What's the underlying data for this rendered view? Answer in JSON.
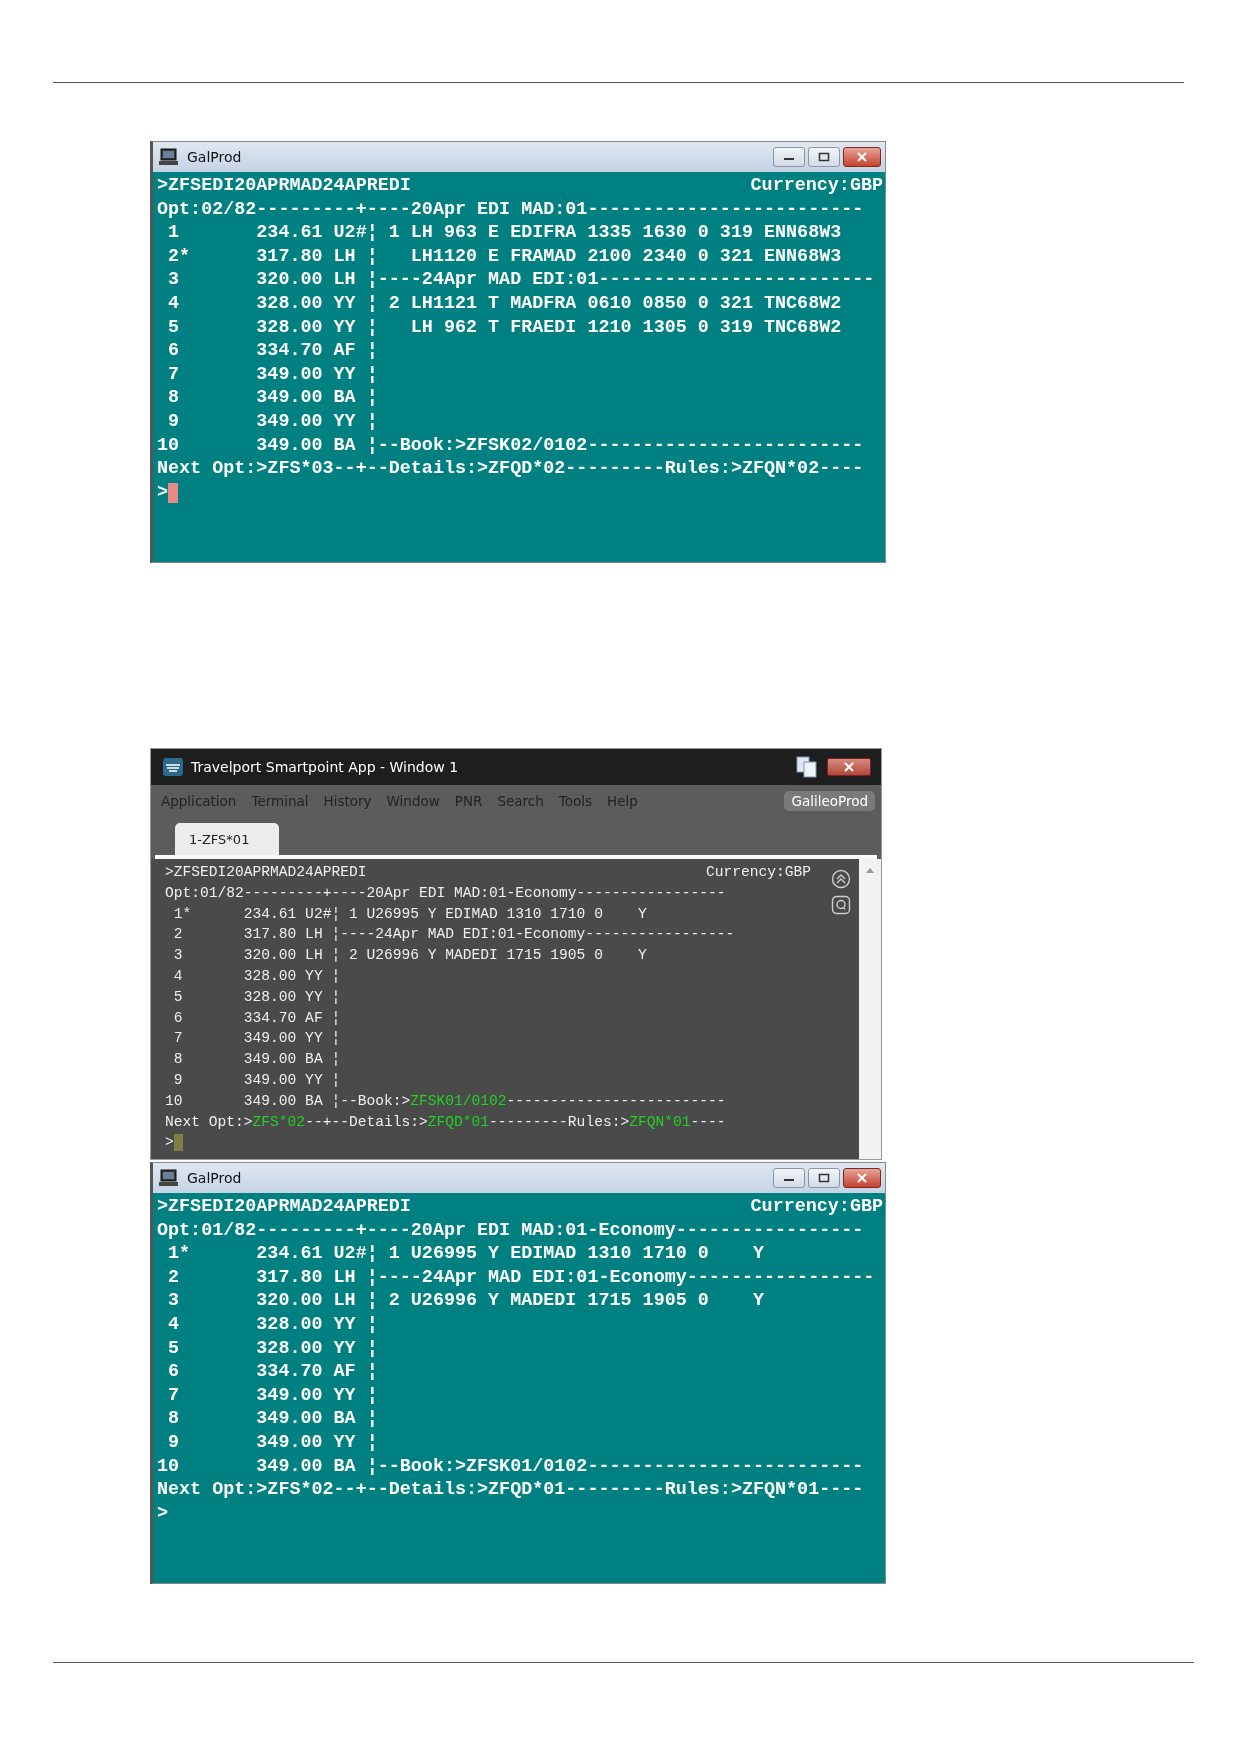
{
  "windows": [
    {
      "kind": "classic",
      "title": "GalProd",
      "terminal": {
        "command": ">ZFSEDI20APRMAD24APREDI",
        "currency": "Currency:GBP",
        "prompt": ">",
        "cursor": true,
        "lines": [
          [
            {
              "text": "Opt:02/82---------+----20Apr EDI MAD:01-------------------------",
              "kind": "plain"
            }
          ],
          [
            {
              "text": " 1       234.61 U2#¦ 1 LH 963 E EDIFRA 1335 1630 0 319 ENN68W3",
              "kind": "plain"
            }
          ],
          [
            {
              "text": " 2*      317.80 LH ¦   LH1120 E FRAMAD 2100 2340 0 321 ENN68W3",
              "kind": "plain"
            }
          ],
          [
            {
              "text": " 3       320.00 LH ¦----24Apr MAD EDI:01-------------------------",
              "kind": "plain"
            }
          ],
          [
            {
              "text": " 4       328.00 YY ¦ 2 LH1121 T MADFRA 0610 0850 0 321 TNC68W2",
              "kind": "plain"
            }
          ],
          [
            {
              "text": " 5       328.00 YY ¦   LH 962 T FRAEDI 1210 1305 0 319 TNC68W2",
              "kind": "plain"
            }
          ],
          [
            {
              "text": " 6       334.70 AF ¦",
              "kind": "plain"
            }
          ],
          [
            {
              "text": " 7       349.00 YY ¦",
              "kind": "plain"
            }
          ],
          [
            {
              "text": " 8       349.00 BA ¦",
              "kind": "plain"
            }
          ],
          [
            {
              "text": " 9       349.00 YY ¦",
              "kind": "plain"
            }
          ],
          [
            {
              "text": "10       349.00 BA ¦--Book:>ZFSK02/0102-------------------------",
              "kind": "plain"
            }
          ],
          [
            {
              "text": "Next Opt:>ZFS*03--+--Details:>ZFQD*02---------Rules:>ZFQN*02----",
              "kind": "plain"
            }
          ]
        ]
      }
    },
    {
      "kind": "smartpoint",
      "title": "Travelport Smartpoint App - Window 1",
      "menu": [
        "Application",
        "Terminal",
        "History",
        "Window",
        "PNR",
        "Search",
        "Tools",
        "Help"
      ],
      "profile": "GalileoProd",
      "tabs": [
        {
          "label": "1-ZFS*01",
          "selected": true
        }
      ],
      "terminal": {
        "command": ">ZFSEDI20APRMAD24APREDI",
        "currency": "Currency:GBP",
        "prompt": ">",
        "cursor": true,
        "lines": [
          [
            {
              "text": "Opt:01/82---------+----20Apr EDI MAD:01-Economy-----------------",
              "kind": "plain"
            }
          ],
          [
            {
              "text": " 1*      234.61 U2#¦ 1 U26995 Y EDIMAD 1310 1710 0    Y",
              "kind": "plain"
            }
          ],
          [
            {
              "text": " 2       317.80 LH ¦----24Apr MAD EDI:01-Economy-----------------",
              "kind": "plain"
            }
          ],
          [
            {
              "text": " 3       320.00 LH ¦ 2 U26996 Y MADEDI 1715 1905 0    Y",
              "kind": "plain"
            }
          ],
          [
            {
              "text": " 4       328.00 YY ¦",
              "kind": "plain"
            }
          ],
          [
            {
              "text": " 5       328.00 YY ¦",
              "kind": "plain"
            }
          ],
          [
            {
              "text": " 6       334.70 AF ¦",
              "kind": "plain"
            }
          ],
          [
            {
              "text": " 7       349.00 YY ¦",
              "kind": "plain"
            }
          ],
          [
            {
              "text": " 8       349.00 BA ¦",
              "kind": "plain"
            }
          ],
          [
            {
              "text": " 9       349.00 YY ¦",
              "kind": "plain"
            }
          ],
          [
            {
              "text": "10       349.00 BA ¦--Book:>",
              "kind": "plain"
            },
            {
              "text": "ZFSK01/0102",
              "kind": "command"
            },
            {
              "text": "-------------------------",
              "kind": "plain"
            }
          ],
          [
            {
              "text": "Next Opt:>",
              "kind": "plain"
            },
            {
              "text": "ZFS*02",
              "kind": "command"
            },
            {
              "text": "--+--Details:>",
              "kind": "plain"
            },
            {
              "text": "ZFQD*01",
              "kind": "command"
            },
            {
              "text": "---------Rules:>",
              "kind": "plain"
            },
            {
              "text": "ZFQN*01",
              "kind": "command"
            },
            {
              "text": "----",
              "kind": "plain"
            }
          ]
        ]
      }
    },
    {
      "kind": "classic",
      "title": "GalProd",
      "terminal": {
        "command": ">ZFSEDI20APRMAD24APREDI",
        "currency": "Currency:GBP",
        "prompt": ">",
        "lines": [
          [
            {
              "text": "Opt:01/82---------+----20Apr EDI MAD:01-Economy-----------------",
              "kind": "plain"
            }
          ],
          [
            {
              "text": " 1*      234.61 U2#¦ 1 U26995 Y EDIMAD 1310 1710 0    Y",
              "kind": "plain"
            }
          ],
          [
            {
              "text": " 2       317.80 LH ¦----24Apr MAD EDI:01-Economy-----------------",
              "kind": "plain"
            }
          ],
          [
            {
              "text": " 3       320.00 LH ¦ 2 U26996 Y MADEDI 1715 1905 0    Y",
              "kind": "plain"
            }
          ],
          [
            {
              "text": " 4       328.00 YY ¦",
              "kind": "plain"
            }
          ],
          [
            {
              "text": " 5       328.00 YY ¦",
              "kind": "plain"
            }
          ],
          [
            {
              "text": " 6       334.70 AF ¦",
              "kind": "plain"
            }
          ],
          [
            {
              "text": " 7       349.00 YY ¦",
              "kind": "plain"
            }
          ],
          [
            {
              "text": " 8       349.00 BA ¦",
              "kind": "plain"
            }
          ],
          [
            {
              "text": " 9       349.00 YY ¦",
              "kind": "plain"
            }
          ],
          [
            {
              "text": "10       349.00 BA ¦--Book:>ZFSK01/0102-------------------------",
              "kind": "plain"
            }
          ],
          [
            {
              "text": "Next Opt:>ZFS*02--+--Details:>ZFQD*01---------Rules:>ZFQN*01----",
              "kind": "plain"
            }
          ]
        ]
      }
    }
  ]
}
